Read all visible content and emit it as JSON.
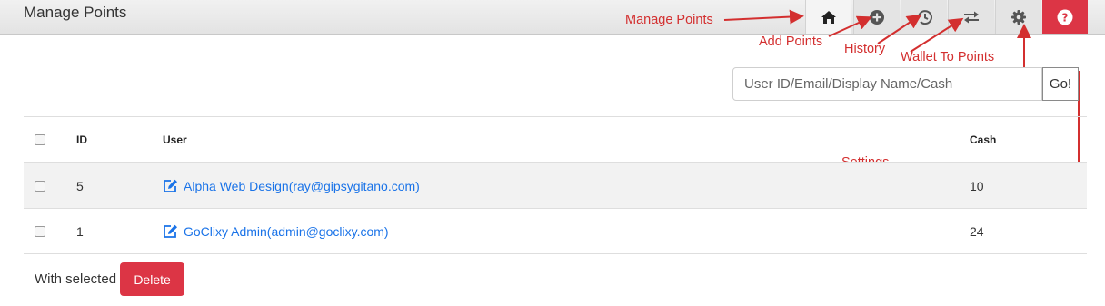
{
  "header": {
    "title": "Manage Points"
  },
  "toolbar": {
    "buttons": [
      {
        "name": "manage-points",
        "icon": "home-icon"
      },
      {
        "name": "add-points",
        "icon": "plus-circle-icon"
      },
      {
        "name": "history",
        "icon": "history-icon"
      },
      {
        "name": "wallet-to-points",
        "icon": "exchange-icon"
      },
      {
        "name": "settings",
        "icon": "gear-icon"
      },
      {
        "name": "help",
        "icon": "question-circle-icon"
      }
    ]
  },
  "annotations": {
    "manage_points": "Manage Points",
    "add_points": "Add Points",
    "history": "History",
    "wallet_to_points": "Wallet To Points",
    "settings": "Settings",
    "color": "#d32f2f"
  },
  "search": {
    "placeholder": "User ID/Email/Display Name/Cash",
    "value": "",
    "go_label": "Go!"
  },
  "table": {
    "columns": {
      "id": "ID",
      "user": "User",
      "cash": "Cash"
    },
    "rows": [
      {
        "id": "5",
        "user": "Alpha Web Design(ray@gipsygitano.com)",
        "cash": "10"
      },
      {
        "id": "1",
        "user": "GoClixy Admin(admin@goclixy.com)",
        "cash": "24"
      }
    ]
  },
  "bulk": {
    "label": "With selected",
    "delete_label": "Delete"
  },
  "colors": {
    "danger": "#dc3545",
    "link": "#1a73e8"
  }
}
